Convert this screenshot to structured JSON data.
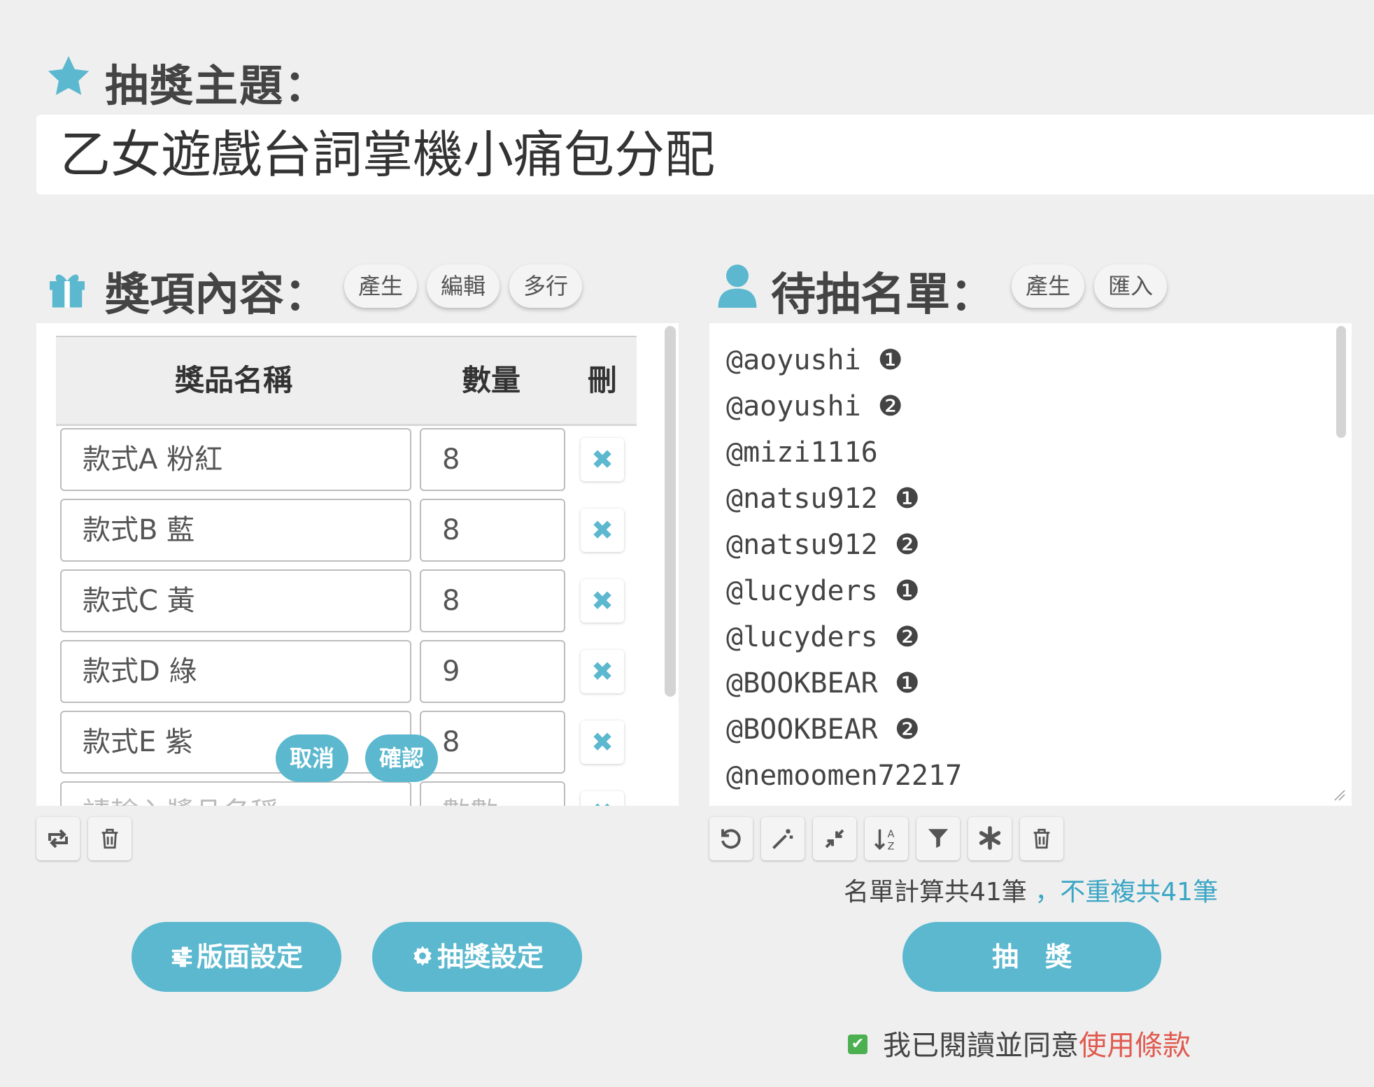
{
  "theme": {
    "label": "抽獎主題：",
    "value": "乙女遊戲台詞掌機小痛包分配"
  },
  "prizes": {
    "label": "獎項內容：",
    "buttons": [
      "產生",
      "編輯",
      "多行"
    ],
    "headers": {
      "name": "獎品名稱",
      "qty": "數量",
      "del": "刪"
    },
    "rows": [
      {
        "name": "款式A 粉紅",
        "qty": "8"
      },
      {
        "name": "款式B 藍",
        "qty": "8"
      },
      {
        "name": "款式C 黃",
        "qty": "8"
      },
      {
        "name": "款式D 綠",
        "qty": "9"
      },
      {
        "name": "款式E 紫",
        "qty": "8"
      }
    ],
    "new_row": {
      "name_placeholder": "請輸入獎品名稱",
      "qty_placeholder": "數數"
    },
    "popover": {
      "cancel": "取消",
      "confirm": "確認"
    }
  },
  "names": {
    "label": "待抽名單：",
    "buttons": [
      "產生",
      "匯入"
    ],
    "list": [
      "@aoyushi ❶",
      "@aoyushi ❷",
      "@mizi1116",
      "@natsu912 ❶",
      "@natsu912 ❷",
      "@lucyders ❶",
      "@lucyders ❷",
      "@BOOKBEAR ❶",
      "@BOOKBEAR ❷",
      "@nemoomen72217"
    ],
    "count_total": "名單計算共41筆",
    "count_unique": "，不重複共41筆"
  },
  "actions": {
    "layout_settings": "版面設定",
    "draw_settings": "抽獎設定",
    "draw": "抽　獎"
  },
  "agreement": {
    "text": "我已閱讀並同意",
    "link": "使用條款",
    "checked": true
  },
  "colors": {
    "accent": "#5bb8cf",
    "link_red": "#e05a4f",
    "background": "#efefef"
  }
}
